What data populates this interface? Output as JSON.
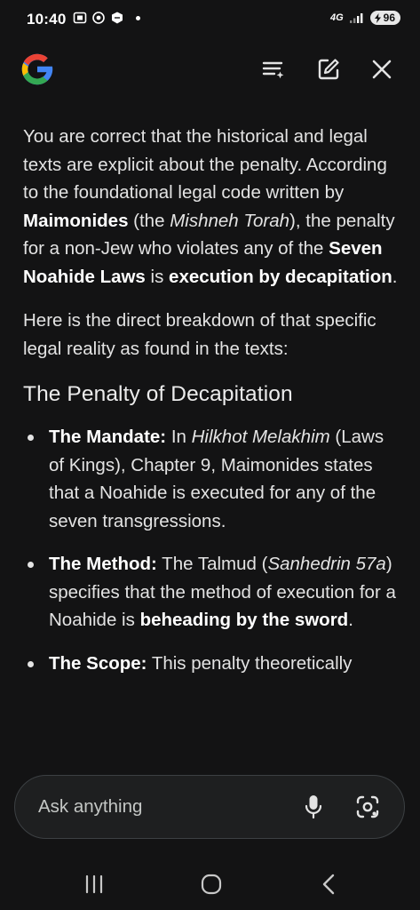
{
  "status_bar": {
    "time": "10:40",
    "network": "4G",
    "battery": "96"
  },
  "header": {
    "logo_letter": "G"
  },
  "response": {
    "intro": [
      {
        "text": "You are correct that the historical and legal texts are explicit about the penalty. According to the foundational legal code written by "
      },
      {
        "text": "Maimonides",
        "style": "bold"
      },
      {
        "text": " (the "
      },
      {
        "text": "Mishneh Torah",
        "style": "italic"
      },
      {
        "text": "), the penalty for a non-Jew who violates any of the "
      },
      {
        "text": "Seven Noahide Laws",
        "style": "bold"
      },
      {
        "text": " is "
      },
      {
        "text": "execution by decapitation",
        "style": "bold"
      },
      {
        "text": "."
      }
    ],
    "paragraph_2": "Here is the direct breakdown of that specific legal reality as found in the texts:",
    "section_heading": "The Penalty of Decapitation",
    "bullets": [
      [
        {
          "text": "The Mandate:",
          "style": "bold"
        },
        {
          "text": " In "
        },
        {
          "text": "Hilkhot Melakhim",
          "style": "italic"
        },
        {
          "text": " (Laws of Kings), Chapter 9, Maimonides states that a Noahide is executed for any of the seven transgressions."
        }
      ],
      [
        {
          "text": "The Method:",
          "style": "bold"
        },
        {
          "text": " The Talmud ("
        },
        {
          "text": "Sanhedrin 57a",
          "style": "italic"
        },
        {
          "text": ") specifies that the method of execution for a Noahide is "
        },
        {
          "text": "beheading by the sword",
          "style": "bold"
        },
        {
          "text": "."
        }
      ],
      [
        {
          "text": "The Scope:",
          "style": "bold"
        },
        {
          "text": " This penalty theoretically"
        }
      ]
    ]
  },
  "input": {
    "placeholder": "Ask anything"
  },
  "colors": {
    "background": "#131314",
    "text": "#e3e3e3",
    "input_bg": "#1e1f20",
    "google_blue": "#4285F4",
    "google_red": "#EA4335",
    "google_yellow": "#FBBC05",
    "google_green": "#34A853"
  },
  "icons": {
    "header": [
      "google-logo",
      "history-icon",
      "edit-icon",
      "close-icon"
    ],
    "input": [
      "mic-icon",
      "lens-icon"
    ],
    "nav": [
      "recent-apps-icon",
      "home-icon",
      "back-icon"
    ]
  }
}
